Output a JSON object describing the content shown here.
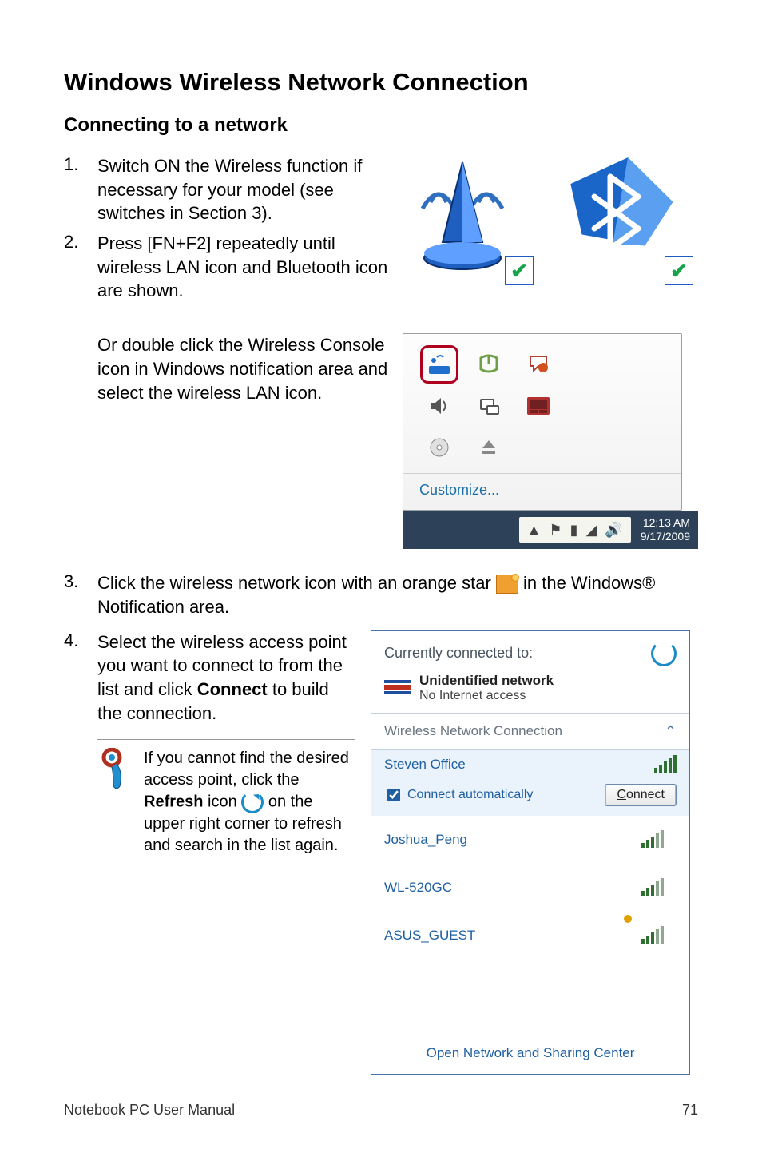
{
  "title": "Windows Wireless Network Connection",
  "subtitle": "Connecting to a network",
  "steps": {
    "s1_num": "1.",
    "s1_text": "Switch ON the Wireless function if necessary for your model (see switches in Section 3).",
    "s2_num": "2.",
    "s2_text": "Press [FN+F2] repeatedly until wireless LAN icon and Bluetooth icon are shown.",
    "console_text": "Or double click the Wireless Console icon in Windows notification area and select the wireless LAN icon.",
    "s3_num": "3.",
    "s3_pre": "Click the wireless network icon with an orange star ",
    "s3_post": " in the Windows® Notification area.",
    "s4_num": "4.",
    "s4_pre": "Select the wireless access point you want to connect to from the list and click ",
    "s4_bold": "Connect",
    "s4_post": " to build the connection."
  },
  "tip": {
    "pre": "If you cannot find the desired access point, click the ",
    "bold": "Refresh",
    "mid": " icon ",
    "post": " on the upper right corner to refresh and search in the list again."
  },
  "console": {
    "customize": "Customize...",
    "time": "12:13 AM",
    "date": "9/17/2009"
  },
  "netpanel": {
    "head": "Currently connected to:",
    "curr_name": "Unidentified network",
    "curr_sub": "No Internet access",
    "subhead": "Wireless Network Connection",
    "items": [
      {
        "name": "Steven Office",
        "selected": true
      },
      {
        "name": "Joshua_Peng"
      },
      {
        "name": "WL-520GC"
      },
      {
        "name": "ASUS_GUEST"
      }
    ],
    "auto_label": "Connect automatically",
    "connect_btn_u": "C",
    "connect_btn_rest": "onnect",
    "foot": "Open Network and Sharing Center"
  },
  "footer": {
    "left": "Notebook PC User Manual",
    "right": "71"
  }
}
